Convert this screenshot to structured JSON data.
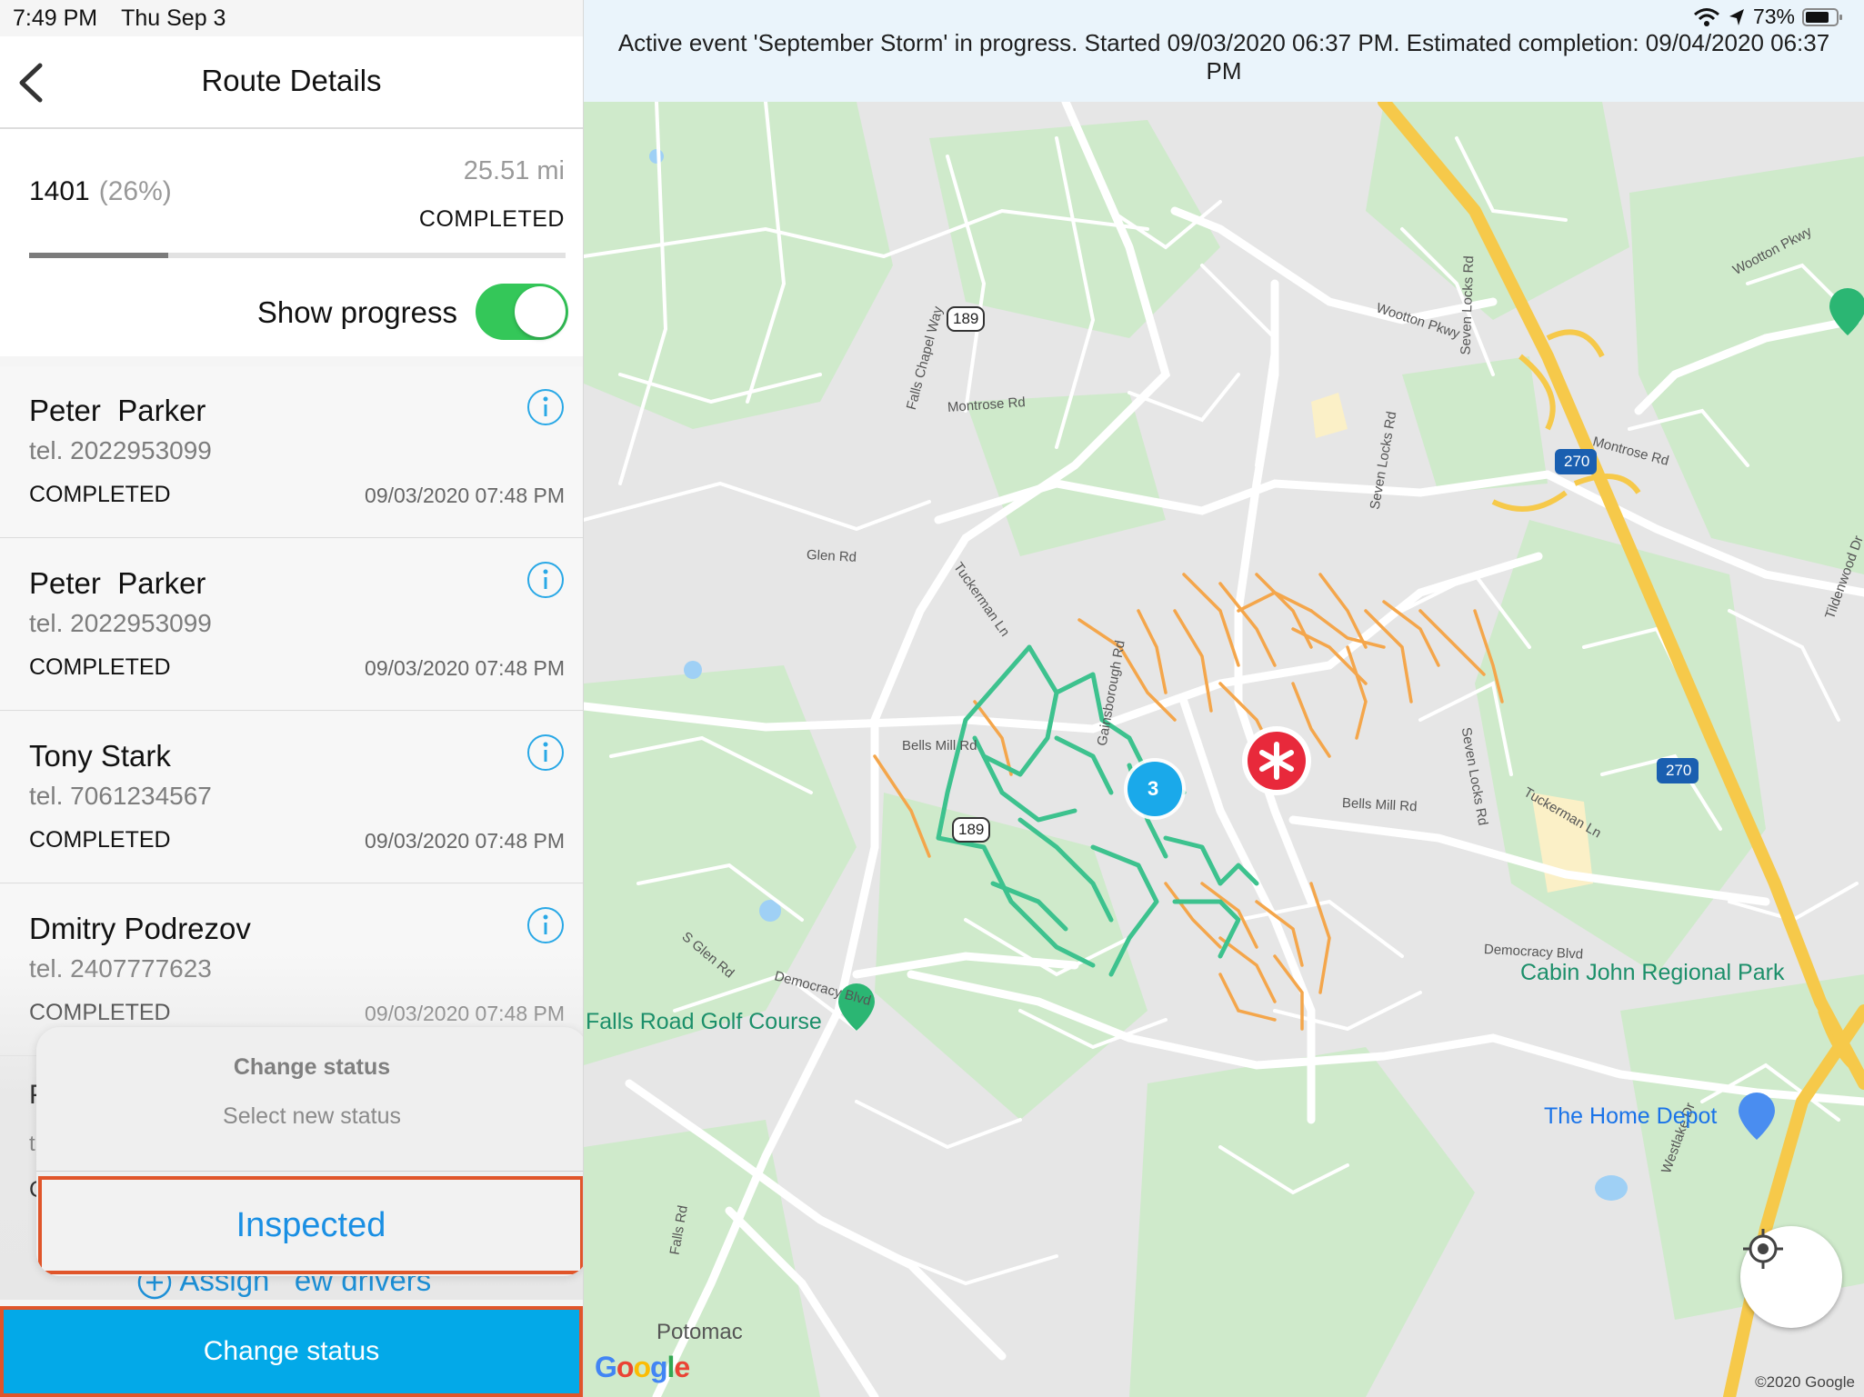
{
  "status_bar": {
    "time": "7:49 PM",
    "date": "Thu Sep 3",
    "battery": "73%"
  },
  "nav": {
    "title": "Route Details"
  },
  "route": {
    "number": "1401",
    "percent": "(26%)",
    "progress_fraction": 0.26,
    "distance": "25.51 mi",
    "status": "COMPLETED",
    "show_progress_label": "Show progress",
    "show_progress_on": true
  },
  "stops": [
    {
      "name": "Peter  Parker",
      "phone": "tel. 2022953099",
      "status": "COMPLETED",
      "date": "09/03/2020 07:48 PM"
    },
    {
      "name": "Peter  Parker",
      "phone": "tel. 2022953099",
      "status": "COMPLETED",
      "date": "09/03/2020 07:48 PM"
    },
    {
      "name": "Tony Stark",
      "phone": "tel. 7061234567",
      "status": "COMPLETED",
      "date": "09/03/2020 07:48 PM"
    },
    {
      "name": "Dmitry Podrezov",
      "phone": "tel. 2407777623",
      "status": "COMPLETED",
      "date": "09/03/2020 07:48 PM"
    }
  ],
  "assign_text": "Assign   ew drivers",
  "action_sheet": {
    "title": "Change status",
    "message": "Select new status",
    "option": "Inspected"
  },
  "change_status_button": "Change status",
  "banner": "Active event 'September Storm' in progress. Started 09/03/2020 06:37 PM. Estimated completion: 09/04/2020 06:37 PM",
  "map": {
    "roads": [
      "Wootton Pkwy",
      "Wootton Pkwy",
      "189",
      "189",
      "Falls Chapel Way",
      "Seven Locks Rd",
      "Seven Locks Rd",
      "Seven Locks Rd",
      "Montrose Rd",
      "Montrose Rd",
      "Tuckerman Ln",
      "Tuckerman Ln",
      "Glen Rd",
      "Bells Mill Rd",
      "Bells Mill Rd",
      "Gainsborough Rd",
      "S Glen Rd",
      "Democracy Blvd",
      "Democracy Blvd",
      "Falls Rd",
      "Westlake Dr",
      "Tildenwood Dr",
      "270",
      "270"
    ],
    "pois": [
      "Falls Road Golf Course",
      "Cabin John Regional Park",
      "The Home Depot",
      "Potomac"
    ],
    "cluster_count": "3",
    "google_logo": "Google",
    "copyright": "©2020 Google"
  },
  "colors": {
    "accent_blue": "#03a9e8",
    "highlight_orange": "#e0552a",
    "toggle_green": "#34c759",
    "route_green": "#3dc28e",
    "route_orange": "#f4a64b",
    "marker_red": "#e8293b"
  }
}
